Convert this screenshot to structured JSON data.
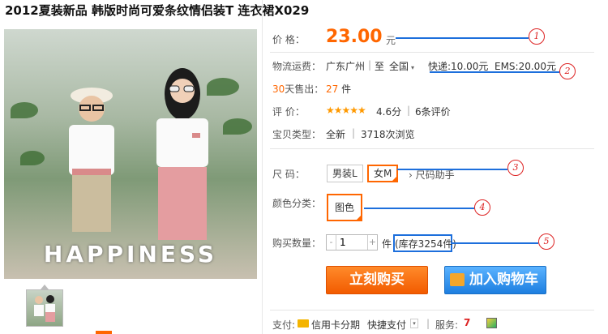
{
  "product": {
    "title": "2012夏装新品 韩版时尚可爱条纹情侣装T 连衣裙X029",
    "photo_banner": "HAPPINESS"
  },
  "price": {
    "label": "价  格：",
    "value": "23.00",
    "unit": "元"
  },
  "shipping": {
    "label": "物流运费：",
    "origin": "广东广州",
    "sep1": "|",
    "to_label": "至",
    "destination": "全国",
    "express": "快递:10.00元",
    "ems": "EMS:20.00元"
  },
  "sales": {
    "days": "30",
    "label_suffix": "天售出：",
    "count": "27",
    "unit": "件"
  },
  "rating": {
    "label": "评  价：",
    "stars": "★★★★★",
    "score": "4.6分",
    "sep": "|",
    "reviews": "6条评价"
  },
  "item_type": {
    "label": "宝贝类型：",
    "value": "全新",
    "sep": "|",
    "views": "3718次浏览"
  },
  "size": {
    "label": "尺  码：",
    "options": [
      "男装L",
      "女M"
    ],
    "selected": "女M",
    "helper": "› 尺码助手"
  },
  "color": {
    "label": "颜色分类：",
    "option": "图色"
  },
  "quantity": {
    "label": "购买数量：",
    "minus": "-",
    "value": "1",
    "plus": "+",
    "unit": "件",
    "stock": "(库存3254件)"
  },
  "buttons": {
    "buy_now": "立刻购买",
    "add_cart": "加入购物车"
  },
  "footer": {
    "pay_label": "支付:",
    "credit_card": "信用卡分期",
    "quick_pay": "快捷支付",
    "service_label": "服务:",
    "sep": "|"
  },
  "annotations": [
    "1",
    "2",
    "3",
    "4",
    "5"
  ],
  "colors": {
    "accent": "#ff6600",
    "annotation_red": "#dd2222",
    "annotation_blue": "#1d6fdc",
    "cart_blue": "#1d7ee0"
  }
}
